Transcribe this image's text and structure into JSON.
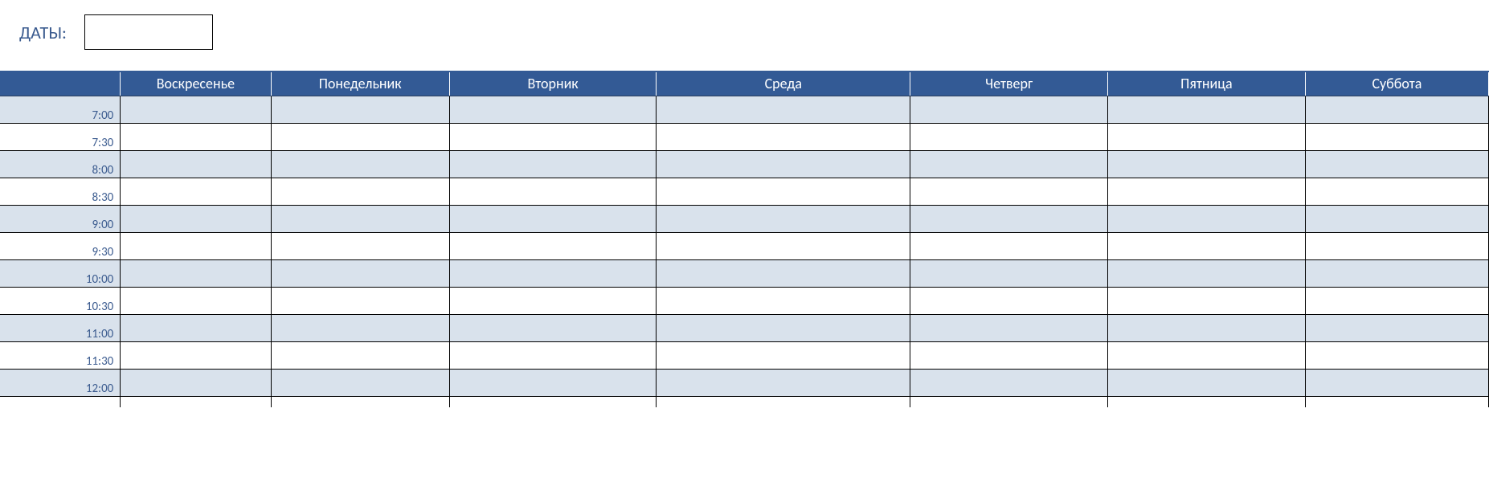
{
  "header": {
    "dates_label": "ДАТЫ:",
    "dates_value": ""
  },
  "days": {
    "sun": "Воскресенье",
    "mon": "Понедельник",
    "tue": "Вторник",
    "wed": "Среда",
    "thu": "Четверг",
    "fri": "Пятница",
    "sat": "Суббота"
  },
  "times": {
    "t0": "7:00",
    "t1": "7:30",
    "t2": "8:00",
    "t3": "8:30",
    "t4": "9:00",
    "t5": "9:30",
    "t6": "10:00",
    "t7": "10:30",
    "t8": "11:00",
    "t9": "11:30",
    "t10": "12:00"
  }
}
